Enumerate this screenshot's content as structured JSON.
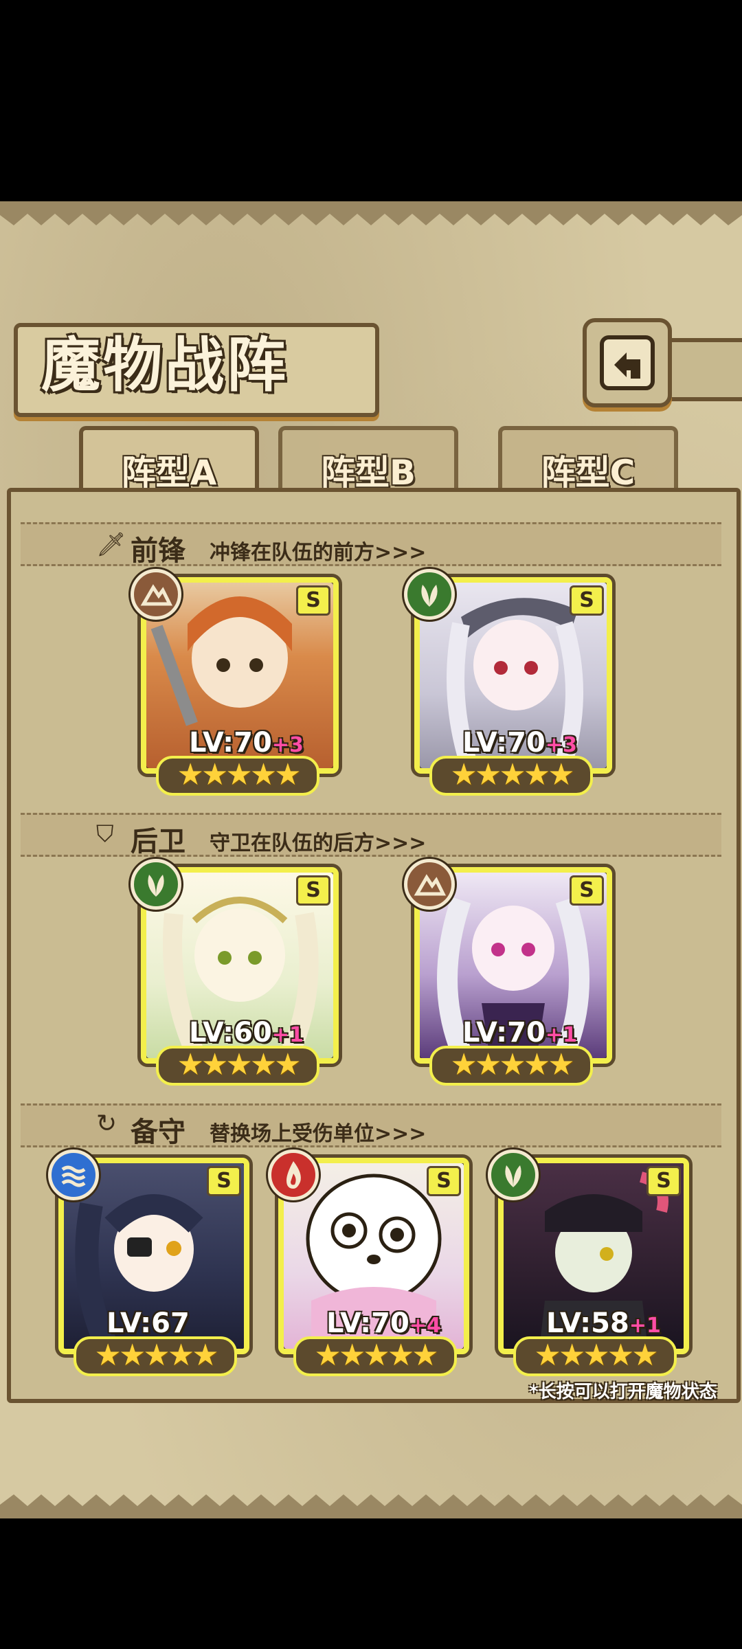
{
  "title": "魔物战阵",
  "tabs": [
    {
      "label": "阵型A",
      "active": true
    },
    {
      "label": "阵型B",
      "active": false
    },
    {
      "label": "阵型C",
      "active": false
    }
  ],
  "sections": {
    "front": {
      "title": "前锋",
      "subtitle": "冲锋在队伍的前方>>>"
    },
    "back": {
      "title": "后卫",
      "subtitle": "守卫在队伍的后方>>>"
    },
    "reserve": {
      "title": "备守",
      "subtitle": "替换场上受伤单位>>>"
    }
  },
  "cards": {
    "front1": {
      "rank": "S",
      "element": "earth-icon",
      "level": "LV:70",
      "bonus": "+3",
      "stars": "★★★★★",
      "elementColor": "#8a5a3a"
    },
    "front2": {
      "rank": "S",
      "element": "leaf-icon",
      "level": "LV:70",
      "bonus": "+3",
      "stars": "★★★★★",
      "elementColor": "#3a7a2e"
    },
    "back1": {
      "rank": "S",
      "element": "leaf-icon",
      "level": "LV:60",
      "bonus": "+1",
      "stars": "★★★★★",
      "elementColor": "#3a7a2e"
    },
    "back2": {
      "rank": "S",
      "element": "earth-icon",
      "level": "LV:70",
      "bonus": "+1",
      "stars": "★★★★★",
      "elementColor": "#8a5a3a"
    },
    "res1": {
      "rank": "S",
      "element": "water-icon",
      "level": "LV:67",
      "bonus": "",
      "stars": "★★★★★",
      "elementColor": "#2f6fd1"
    },
    "res2": {
      "rank": "S",
      "element": "fire-icon",
      "level": "LV:70",
      "bonus": "+4",
      "stars": "★★★★★",
      "elementColor": "#c9302c"
    },
    "res3": {
      "rank": "S",
      "element": "leaf-icon",
      "level": "LV:58",
      "bonus": "+1",
      "stars": "★★★★★",
      "elementColor": "#3a7a2e"
    }
  },
  "hint": "*长按可以打开魔物状态"
}
